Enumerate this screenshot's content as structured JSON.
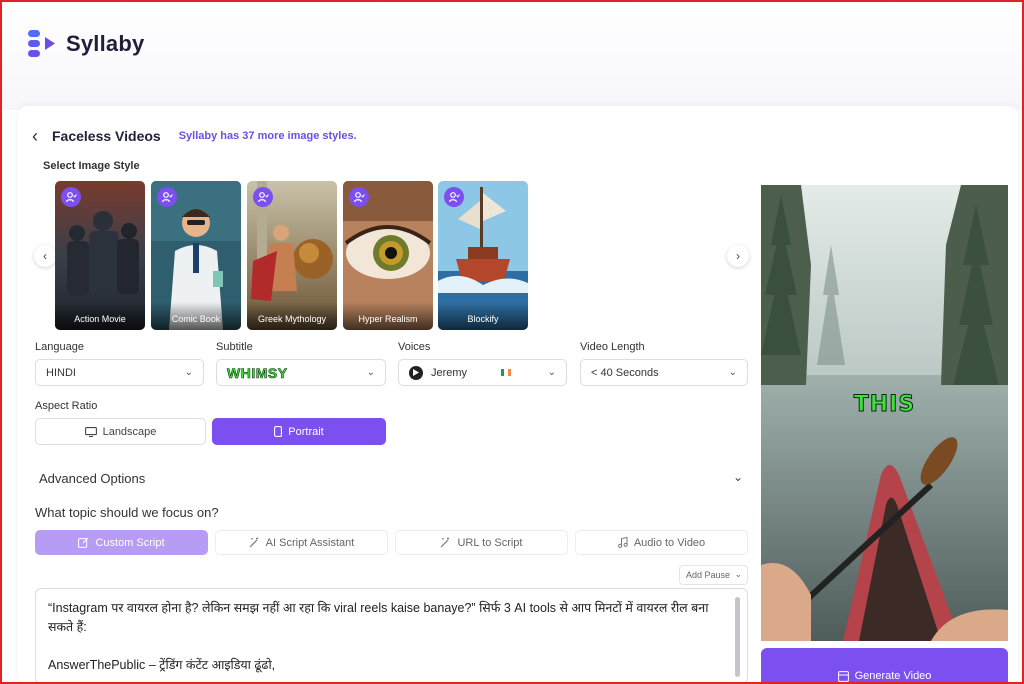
{
  "app": {
    "name": "Syllaby",
    "brand_color": "#7b4ff0"
  },
  "header": {
    "title": "Faceless Videos",
    "promo": "Syllaby has 37 more image styles."
  },
  "image_styles": {
    "label": "Select Image Style",
    "items": [
      {
        "name": "Action Movie"
      },
      {
        "name": "Comic Book"
      },
      {
        "name": "Greek Mythology"
      },
      {
        "name": "Hyper Realism"
      },
      {
        "name": "Blockify"
      }
    ]
  },
  "fields": {
    "language": {
      "label": "Language",
      "value": "HINDI"
    },
    "subtitle": {
      "label": "Subtitle",
      "value": "WHIMSY"
    },
    "voices": {
      "label": "Voices",
      "value": "Jeremy"
    },
    "video_length": {
      "label": "Video Length",
      "value": "< 40 Seconds"
    }
  },
  "aspect_ratio": {
    "label": "Aspect Ratio",
    "options": [
      "Landscape",
      "Portrait"
    ],
    "selected": "Portrait"
  },
  "advanced": {
    "label": "Advanced Options"
  },
  "topic": {
    "label": "What topic should we focus on?",
    "tabs": [
      "Custom Script",
      "AI Script Assistant",
      "URL to Script",
      "Audio to Video"
    ],
    "active_tab": "Custom Script"
  },
  "script": {
    "add_pause": "Add Pause",
    "line1": "“Instagram पर वायरल होना है? लेकिन समझ नहीं आ रहा कि viral reels kaise banaye?” सिर्फ 3 AI tools से आप मिनटों में वायरल रील बना सकते हैं:",
    "line2": "AnswerThePublic – ट्रेंडिंग कंटेंट आइडिया ढूंढो,"
  },
  "preview": {
    "caption": "THIS"
  },
  "generate": {
    "label": "Generate Video"
  }
}
